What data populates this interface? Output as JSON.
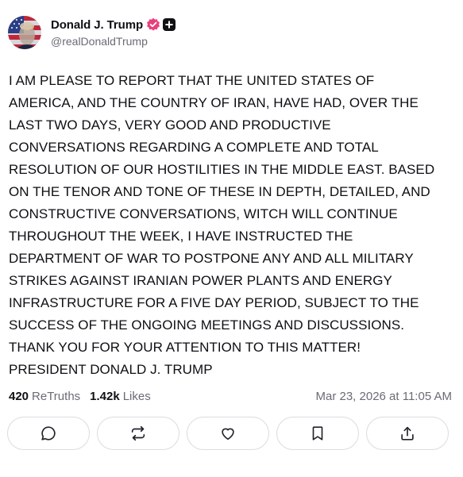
{
  "author": {
    "display_name": "Donald J. Trump",
    "handle": "@realDonaldTrump",
    "verified_badge_icon": "verified-check-icon",
    "plus_badge_icon": "plus-badge-icon"
  },
  "post": {
    "lines": [
      "I AM PLEASE TO REPORT THAT THE UNITED STATES OF",
      "AMERICA, AND THE COUNTRY OF IRAN, HAVE HAD, OVER THE",
      "LAST TWO DAYS, VERY GOOD AND PRODUCTIVE",
      "CONVERSATIONS REGARDING A COMPLETE AND TOTAL",
      "RESOLUTION OF OUR HOSTILITIES IN THE MIDDLE EAST. BASED",
      "ON THE TENOR AND TONE OF THESE IN DEPTH, DETAILED, AND",
      "CONSTRUCTIVE CONVERSATIONS, WITCH WILL CONTINUE",
      "THROUGHOUT THE WEEK, I HAVE INSTRUCTED THE",
      "DEPARTMENT OF WAR TO POSTPONE ANY AND ALL MILITARY",
      "STRIKES AGAINST IRANIAN POWER PLANTS AND ENERGY",
      "INFRASTRUCTURE FOR A FIVE DAY PERIOD, SUBJECT TO THE",
      "SUCCESS OF THE ONGOING MEETINGS AND DISCUSSIONS.",
      "THANK YOU FOR YOUR ATTENTION TO THIS MATTER!",
      "PRESIDENT DONALD J. TRUMP"
    ]
  },
  "stats": {
    "retruths_count": "420",
    "retruths_label": "ReTruths",
    "likes_count": "1.42k",
    "likes_label": "Likes",
    "timestamp": "Mar 23, 2026 at 11:05 AM"
  },
  "actions": [
    {
      "icon": "reply-icon"
    },
    {
      "icon": "retruth-icon"
    },
    {
      "icon": "heart-icon"
    },
    {
      "icon": "bookmark-icon"
    },
    {
      "icon": "share-icon"
    }
  ],
  "colors": {
    "text": "#0f0f14",
    "muted": "#6b6b76",
    "border": "#dcdce2",
    "verified": "#e8407a"
  }
}
